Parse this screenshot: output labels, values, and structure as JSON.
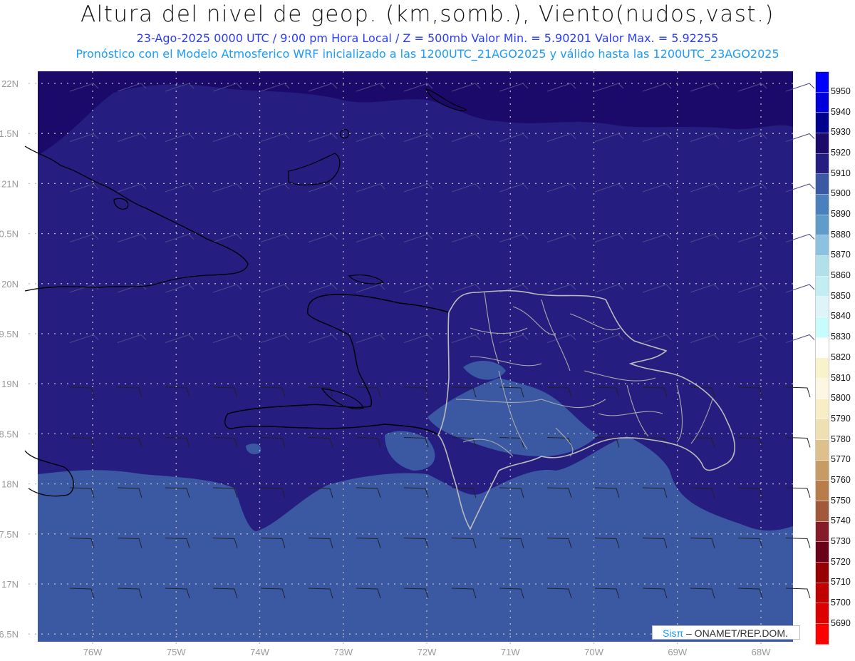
{
  "header": {
    "title": "Altura del nivel de geop. (km,somb.), Viento(nudos,vast.)",
    "subtitle": "23-Ago-2025  0000 UTC / 9:00 pm Hora Local / Z = 500mb    Valor Min. = 5.90201  Valor Max. = 5.92255",
    "model_line": "Pronóstico con el Modelo Atmosferico WRF inicializado a las 1200UTC_21AGO2025 y válido hasta las  1200UTC_23AGO2025"
  },
  "map": {
    "lat_labels": [
      "22N",
      "1.5N",
      "21N",
      "0.5N",
      "20N",
      "9.5N",
      "19N",
      "8.5N",
      "18N",
      "7.5N",
      "17N",
      "6.5N"
    ],
    "lon_labels": [
      "76W",
      "75W",
      "74W",
      "73W",
      "72W",
      "71W",
      "70W",
      "69W",
      "68W"
    ],
    "fill_colors": {
      "dark_band": "#1c0a6a",
      "main": "#251d80",
      "light": "#3b58a3"
    }
  },
  "colorbar": {
    "labels": [
      "5950",
      "5940",
      "5930",
      "5920",
      "5910",
      "5900",
      "5890",
      "5880",
      "5870",
      "5860",
      "5850",
      "5840",
      "5830",
      "5820",
      "5810",
      "5800",
      "5790",
      "5780",
      "5770",
      "5760",
      "5750",
      "5740",
      "5730",
      "5720",
      "5710",
      "5700",
      "5690"
    ],
    "colors": [
      "#0000ff",
      "#0000dd",
      "#00008e",
      "#1c0a6a",
      "#251d80",
      "#3b58a3",
      "#4a80bb",
      "#5f9cca",
      "#8dc1e0",
      "#b1dfea",
      "#c2edf3",
      "#ddf5f8",
      "#c8fbfc",
      "#ffffff",
      "#f9f3cc",
      "#fcf6e2",
      "#f7eec6",
      "#eee0b2",
      "#ddc08b",
      "#c79b64",
      "#b87d4b",
      "#a2593b",
      "#861b2a",
      "#6b0019",
      "#960000",
      "#c00000",
      "#dd0000",
      "#ff0000"
    ]
  },
  "credit": {
    "brand": "SisPI",
    "brand_glyph": "Sisπ",
    "text": "– ONAMET/REP.DOM."
  }
}
